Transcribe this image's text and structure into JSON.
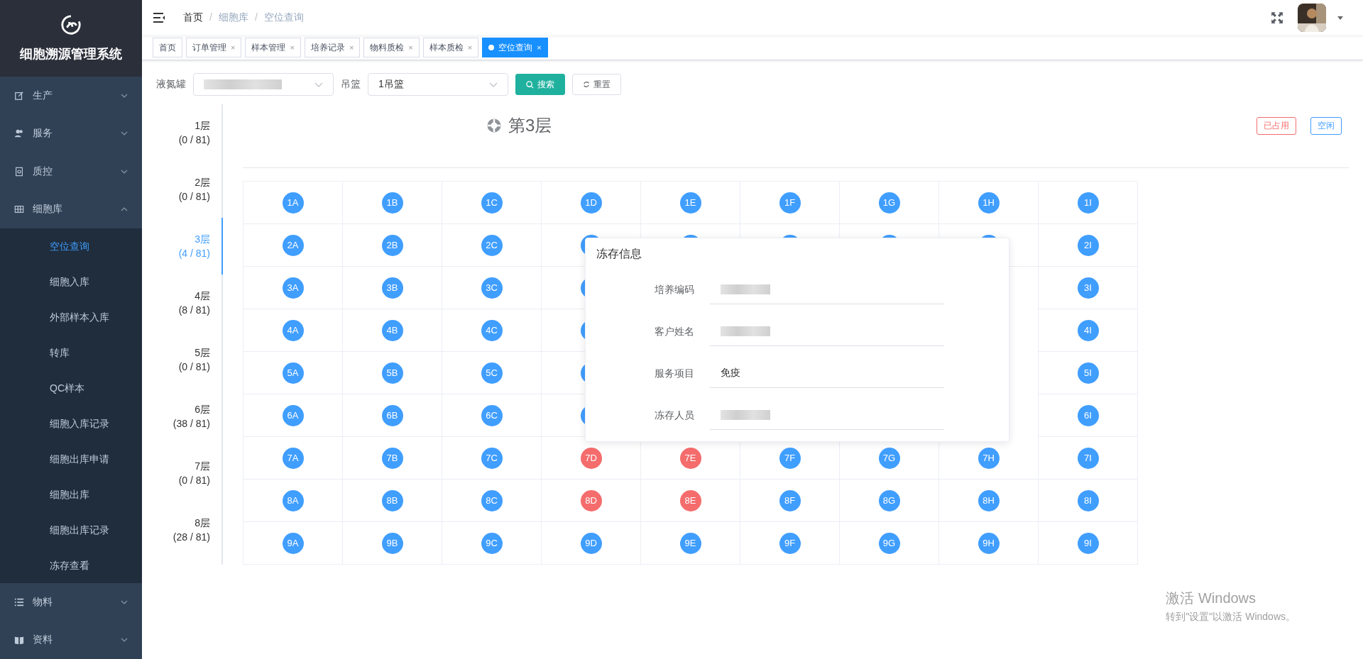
{
  "sidebar": {
    "title": "细胞溯源管理系统",
    "items": [
      {
        "label": "生产",
        "expanded": false
      },
      {
        "label": "服务",
        "expanded": false
      },
      {
        "label": "质控",
        "expanded": false
      },
      {
        "label": "细胞库",
        "expanded": true,
        "children": [
          {
            "label": "空位查询",
            "selected": true
          },
          {
            "label": "细胞入库",
            "selected": false
          },
          {
            "label": "外部样本入库",
            "selected": false
          },
          {
            "label": "转库",
            "selected": false
          },
          {
            "label": "QC样本",
            "selected": false
          },
          {
            "label": "细胞入库记录",
            "selected": false
          },
          {
            "label": "细胞出库申请",
            "selected": false
          },
          {
            "label": "细胞出库",
            "selected": false
          },
          {
            "label": "细胞出库记录",
            "selected": false
          },
          {
            "label": "冻存查看",
            "selected": false
          }
        ]
      },
      {
        "label": "物料",
        "expanded": false
      },
      {
        "label": "资料",
        "expanded": false
      }
    ]
  },
  "breadcrumb": [
    {
      "label": "首页",
      "link": false
    },
    {
      "separator": "/",
      "label": "细胞库",
      "link": true
    },
    {
      "separator": "/",
      "label": "空位查询",
      "link": true
    }
  ],
  "tabs": [
    {
      "label": "首页",
      "closable": false,
      "selected": false
    },
    {
      "label": "订单管理",
      "closable": true,
      "selected": false
    },
    {
      "label": "样本管理",
      "closable": true,
      "selected": false
    },
    {
      "label": "培养记录",
      "closable": true,
      "selected": false
    },
    {
      "label": "物料质检",
      "closable": true,
      "selected": false
    },
    {
      "label": "样本质检",
      "closable": true,
      "selected": false
    },
    {
      "label": "空位查询",
      "closable": true,
      "selected": true
    }
  ],
  "close_glyph": "×",
  "filters": {
    "tank": {
      "label": "液氮罐",
      "blurred": true
    },
    "basket": {
      "label": "吊篮",
      "value": "1吊篮"
    },
    "search_button": "搜索",
    "reset_button": "重置"
  },
  "levels": [
    {
      "label": "1层",
      "count": "(0 / 81)",
      "selected": false
    },
    {
      "label": "2层",
      "count": "(0 / 81)",
      "selected": false
    },
    {
      "label": "3层",
      "count": "(4 / 81)",
      "selected": true
    },
    {
      "label": "4层",
      "count": "(8 / 81)",
      "selected": false
    },
    {
      "label": "5层",
      "count": "(0 / 81)",
      "selected": false
    },
    {
      "label": "6层",
      "count": "(38 / 81)",
      "selected": false
    },
    {
      "label": "7层",
      "count": "(0 / 81)",
      "selected": false
    },
    {
      "label": "8层",
      "count": "(28 / 81)",
      "selected": false
    }
  ],
  "level_title": "第3层",
  "legend": [
    {
      "label": "已占用",
      "color": "#f56c6c"
    },
    {
      "label": "空闲",
      "color": "#409eff"
    }
  ],
  "grid": [
    [
      {
        "label": "1A",
        "occupied": false
      },
      {
        "label": "1B",
        "occupied": false
      },
      {
        "label": "1C",
        "occupied": false
      },
      {
        "label": "1D",
        "occupied": false
      },
      {
        "label": "1E",
        "occupied": false
      },
      {
        "label": "1F",
        "occupied": false
      },
      {
        "label": "1G",
        "occupied": false
      },
      {
        "label": "1H",
        "occupied": false
      },
      {
        "label": "1I",
        "occupied": false
      }
    ],
    [
      {
        "label": "2A",
        "occupied": false
      },
      {
        "label": "2B",
        "occupied": false
      },
      {
        "label": "2C",
        "occupied": false
      },
      {
        "occupied": false
      },
      {
        "occupied": false
      },
      {
        "occupied": false
      },
      {
        "occupied": false
      },
      {
        "occupied": false
      },
      {
        "label": "2I",
        "occupied": false
      }
    ],
    {
      "cells": [
        {
          "label": "3A",
          "occupied": false
        },
        {
          "label": "3B",
          "occupied": false
        },
        {
          "label": "3C",
          "occupied": false
        },
        {
          "occupied": false
        }
      ],
      "cells_end": [
        {
          "label": "3I",
          "occupied": false
        }
      ]
    },
    {
      "cells": [
        {
          "label": "4A",
          "occupied": false
        },
        {
          "label": "4B",
          "occupied": false
        },
        {
          "label": "4C",
          "occupied": false
        },
        {
          "occupied": false
        }
      ],
      "cells_end": [
        {
          "label": "4I",
          "occupied": false
        }
      ]
    },
    {
      "cells": [
        {
          "label": "5A",
          "occupied": false
        },
        {
          "label": "5B",
          "occupied": false
        },
        {
          "label": "5C",
          "occupied": false
        },
        {
          "occupied": false
        }
      ],
      "cells_end": [
        {
          "label": "5I",
          "occupied": false
        }
      ]
    },
    {
      "cells": [
        {
          "label": "6A",
          "occupied": false
        },
        {
          "label": "6B",
          "occupied": false
        },
        {
          "label": "6C",
          "occupied": false
        },
        {
          "occupied": false
        }
      ],
      "cells_end": [
        {
          "label": "6I",
          "occupied": false
        }
      ]
    },
    [
      {
        "label": "7A",
        "occupied": false
      },
      {
        "label": "7B",
        "occupied": false
      },
      {
        "label": "7C",
        "occupied": false
      },
      {
        "label": "7D",
        "occupied": true
      },
      {
        "label": "7E",
        "occupied": true
      },
      {
        "label": "7F",
        "occupied": false
      },
      {
        "label": "7G",
        "occupied": false
      },
      {
        "label": "7H",
        "occupied": false
      },
      {
        "label": "7I",
        "occupied": false
      }
    ],
    [
      {
        "label": "8A",
        "occupied": false
      },
      {
        "label": "8B",
        "occupied": false
      },
      {
        "label": "8C",
        "occupied": false
      },
      {
        "label": "8D",
        "occupied": true
      },
      {
        "label": "8E",
        "occupied": true
      },
      {
        "label": "8F",
        "occupied": false
      },
      {
        "label": "8G",
        "occupied": false
      },
      {
        "label": "8H",
        "occupied": false
      },
      {
        "label": "8I",
        "occupied": false
      }
    ],
    [
      {
        "label": "9A",
        "occupied": false
      },
      {
        "label": "9B",
        "occupied": false
      },
      {
        "label": "9C",
        "occupied": false
      },
      {
        "label": "9D",
        "occupied": false
      },
      {
        "label": "9E",
        "occupied": false
      },
      {
        "label": "9F",
        "occupied": false
      },
      {
        "label": "9G",
        "occupied": false
      },
      {
        "label": "9H",
        "occupied": false
      },
      {
        "label": "9I",
        "occupied": false
      }
    ]
  ],
  "popup": {
    "title": "冻存信息",
    "fields": [
      {
        "label": "培养编码",
        "blurred": true
      },
      {
        "label": "客户姓名",
        "blurred": true
      },
      {
        "label": "服务项目",
        "value": "免疫"
      },
      {
        "label": "冻存人员",
        "blurred": true
      }
    ]
  },
  "os_watermark": {
    "title": "激活 Windows",
    "text": "转到\"设置\"以激活 Windows。"
  }
}
